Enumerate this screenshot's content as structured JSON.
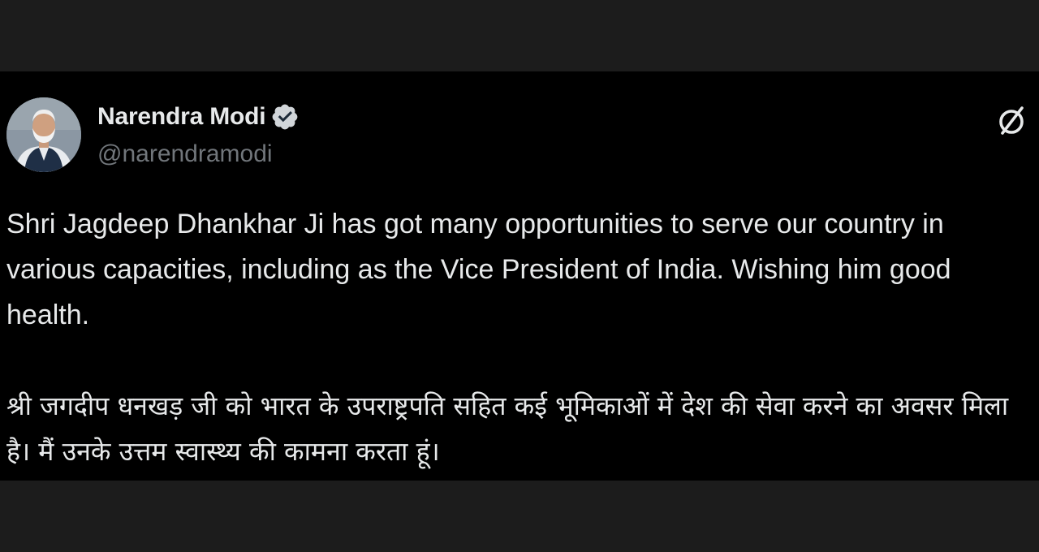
{
  "post": {
    "author": {
      "display_name": "Narendra Modi",
      "handle": "@narendramodi",
      "verified": true,
      "verified_color": "#1d9bf0",
      "avatar_icon": "profile-photo"
    },
    "brand_icon": "x-logo-icon",
    "text_en": "Shri Jagdeep Dhankhar Ji has got many opportunities to serve our country in various capacities, including as the Vice President of India. Wishing him good health.",
    "text_hi": "श्री जगदीप धनखड़ जी को भारत के उपराष्ट्रपति सहित कई भूमिकाओं में देश की सेवा करने का अवसर मिला है। मैं उनके उत्तम स्वास्थ्य की कामना करता हूं।"
  },
  "colors": {
    "background": "#000000",
    "outer_band": "#1c1c1c",
    "primary_text": "#e7e9ea",
    "secondary_text": "#71767b"
  }
}
